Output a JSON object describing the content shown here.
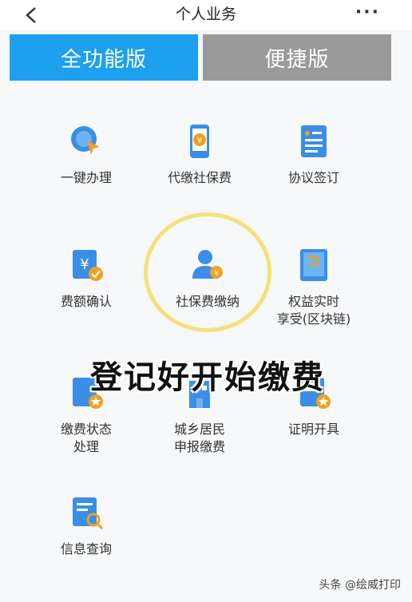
{
  "header": {
    "title": "个人业务",
    "more_label": "···"
  },
  "tabs": [
    {
      "label": "全功能版",
      "active": true
    },
    {
      "label": "便捷版",
      "active": false
    }
  ],
  "items": [
    {
      "label": "一键办理",
      "icon": "one-click-icon"
    },
    {
      "label": "代缴社保费",
      "icon": "phone-payment-icon"
    },
    {
      "label": "协议签订",
      "icon": "document-icon"
    },
    {
      "label": "费额确认",
      "icon": "fee-confirm-icon"
    },
    {
      "label": "社保费缴纳",
      "icon": "user-payment-icon"
    },
    {
      "label": "权益实时\n享受(区块链)",
      "icon": "blockchain-book-icon"
    },
    {
      "label": "缴费状态\n处理",
      "icon": "status-icon"
    },
    {
      "label": "城乡居民\n申报缴费",
      "icon": "resident-icon"
    },
    {
      "label": "证明开具",
      "icon": "certificate-icon"
    },
    {
      "label": "信息查询",
      "icon": "info-search-icon"
    }
  ],
  "overlay_caption": "登记好开始缴费",
  "watermark": "头条 @绘威打印",
  "colors": {
    "accent": "#1ea0f0",
    "inactive_tab": "#9a9a9a",
    "icon_blue": "#3a8ee6",
    "icon_orange": "#f0a020",
    "highlight": "#f5e07a"
  }
}
